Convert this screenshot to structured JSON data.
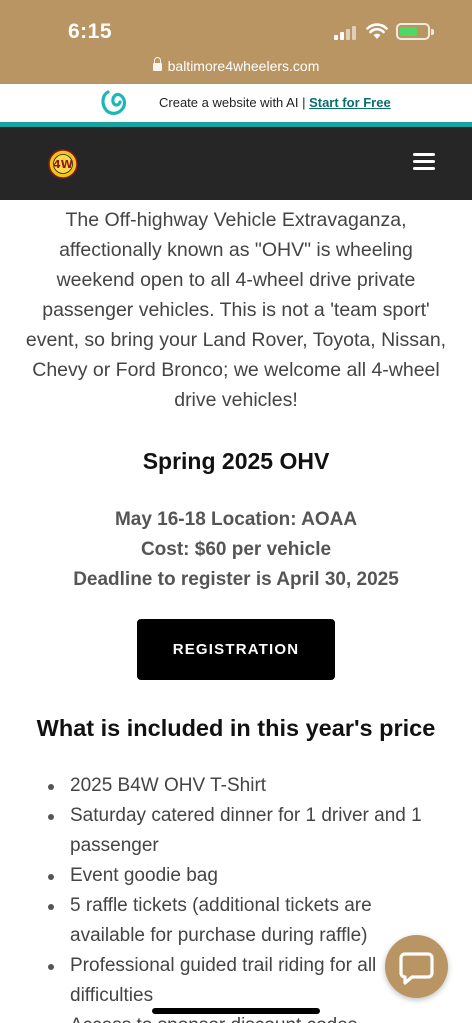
{
  "status_bar": {
    "time": "6:15",
    "url": "baltimore4wheelers.com",
    "lock_icon": "lock-icon",
    "signal_icon": "cellular-signal-icon",
    "wifi_icon": "wifi-icon",
    "battery_icon": "battery-charging-icon"
  },
  "promo": {
    "text": "Create a website with AI | ",
    "link": "Start for Free",
    "logo_icon": "godaddy-logo-icon"
  },
  "header": {
    "logo_icon": "baltimore-4wheelers-logo",
    "menu_icon": "hamburger-menu-icon"
  },
  "main": {
    "intro": "The Off-highway Vehicle Extravaganza, affectionally known as \"OHV\" is wheeling weekend open to all 4-wheel drive private passenger vehicles.  This is not a 'team sport' event, so bring your Land Rover, Toyota, Nissan, Chevy or Ford Bronco; we welcome all 4-wheel drive vehicles!",
    "event_title": "Spring 2025 OHV",
    "event_lines": [
      "May 16-18 Location: AOAA",
      "Cost: $60 per vehicle",
      "Deadline to register is April 30, 2025"
    ],
    "registration_label": "REGISTRATION",
    "included_title": "What is included in this year's price",
    "included_items": [
      "2025 B4W OHV T-Shirt",
      "Saturday catered dinner for 1 driver and 1 passenger",
      "Event goodie bag",
      "5 raffle tickets (additional tickets are available for purchase during raffle)",
      "Professional guided trail riding for all difficulties",
      "Access to sponsor discount codes"
    ]
  },
  "chat": {
    "icon": "chat-bubble-icon"
  },
  "colors": {
    "accent": "#b99563",
    "header": "#262626",
    "teal": "#17a2a2",
    "button": "#000000"
  }
}
